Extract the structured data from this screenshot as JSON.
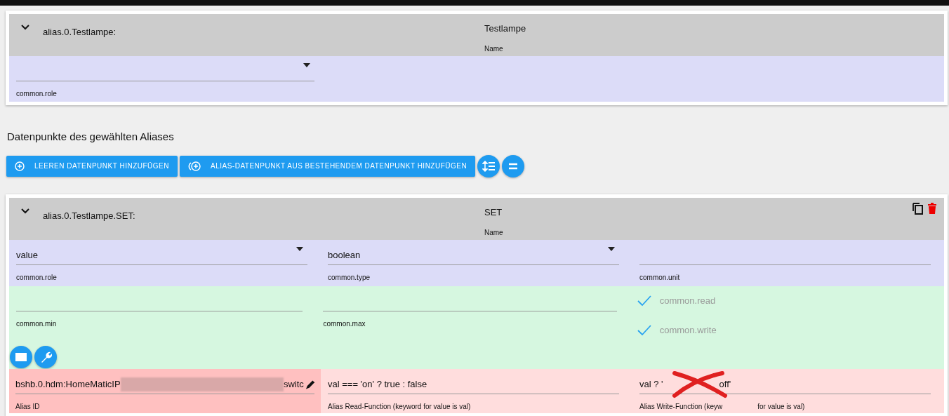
{
  "top_alias": {
    "id": "alias.0.Testlampe:",
    "expanded": true,
    "name": {
      "value": "Testlampe",
      "label": "Name"
    },
    "fields": [
      {
        "kind": "select",
        "label": "common.role"
      }
    ]
  },
  "section_title": "Datenpunkte des gewählten Aliases",
  "toolbar": [
    {
      "kind": "text",
      "label": "LEEREN DATENPUNKT HINZUFÜGEN"
    },
    {
      "kind": "text",
      "label": "ALIAS-DATENPUNKT AUS BESTEHENDEM DATENPUNKT HINZUFÜGEN"
    },
    {
      "kind": "round"
    },
    {
      "kind": "round"
    }
  ],
  "datapoint": {
    "id": "alias.0.Testlampe.SET:",
    "expanded": true,
    "name": {
      "value": "SET",
      "label": "Name"
    },
    "common": [
      {
        "kind": "select",
        "value": "value",
        "label": "common.role"
      },
      {
        "kind": "select",
        "value": "boolean",
        "label": "common.type"
      },
      {
        "kind": "text",
        "label": "common.unit"
      }
    ],
    "limits": [
      {
        "kind": "text",
        "label": "common.min"
      },
      {
        "kind": "text",
        "label": "common.max"
      }
    ],
    "checks": [
      {
        "label": "common.read",
        "checked": true
      },
      {
        "label": "common.write",
        "checked": true
      }
    ],
    "alias_id": {
      "value_start": "bshb.0.hdm:HomeMaticIP",
      "redacted": true,
      "value_end": "switc",
      "label": "Alias ID"
    },
    "read_function": {
      "value": "val === 'on' ? true : false",
      "label": "Alias Read-Function (keyword for value is val)"
    },
    "write_function": {
      "value_parts": [
        "val ? '",
        "off'"
      ],
      "label_parts": [
        "Alias Write-Function (keyw",
        "for value is val)"
      ],
      "crossed_out": true
    }
  }
}
